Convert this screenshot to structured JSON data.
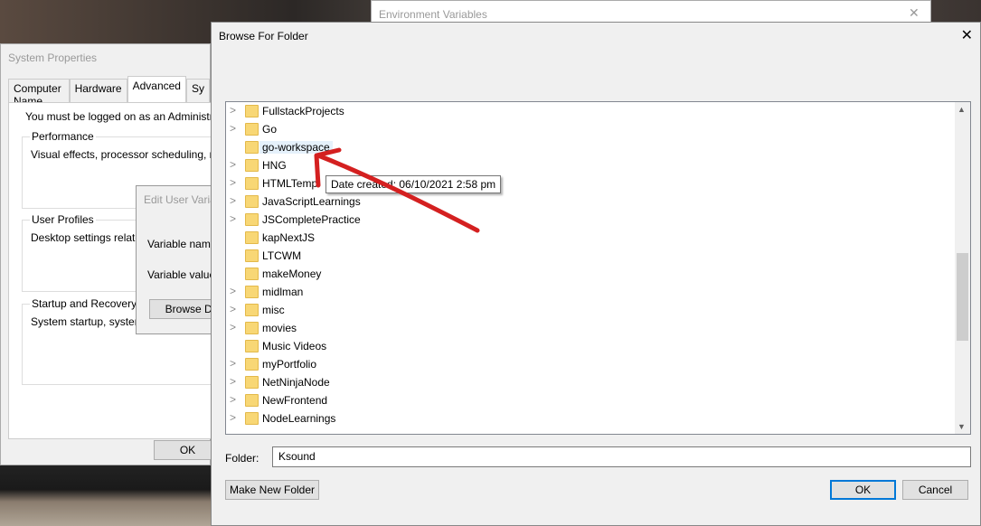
{
  "env_window": {
    "title": "Environment Variables",
    "close": "✕"
  },
  "system_properties": {
    "title": "System Properties",
    "tabs": [
      "Computer Name",
      "Hardware",
      "Advanced",
      "Sy"
    ],
    "notice": "You must be logged on as an Administrator t",
    "groups": [
      {
        "label": "Performance",
        "desc": "Visual effects, processor scheduling, memo"
      },
      {
        "label": "User Profiles",
        "desc": "Desktop settings related t"
      },
      {
        "label": "Startup and Recovery",
        "desc": "System startup, system fa"
      }
    ],
    "ok": "OK"
  },
  "edit_user_variable": {
    "title": "Edit User Varia",
    "name_label": "Variable nam",
    "value_label": "Variable value",
    "browse": "Browse Di"
  },
  "browse": {
    "title": "Browse For Folder",
    "close": "✕",
    "items": [
      {
        "name": "FullstackProjects",
        "expandable": true
      },
      {
        "name": "Go",
        "expandable": true
      },
      {
        "name": "go-workspace",
        "expandable": false,
        "selected": true
      },
      {
        "name": "HNG",
        "expandable": true
      },
      {
        "name": "HTMLTemp",
        "expandable": true
      },
      {
        "name": "JavaScriptLearnings",
        "expandable": true
      },
      {
        "name": "JSCompletePractice",
        "expandable": true
      },
      {
        "name": "kapNextJS",
        "expandable": false
      },
      {
        "name": "LTCWM",
        "expandable": false
      },
      {
        "name": "makeMoney",
        "expandable": false
      },
      {
        "name": "midlman",
        "expandable": true
      },
      {
        "name": "misc",
        "expandable": true
      },
      {
        "name": "movies",
        "expandable": true
      },
      {
        "name": "Music Videos",
        "expandable": false
      },
      {
        "name": "myPortfolio",
        "expandable": true
      },
      {
        "name": "NetNinjaNode",
        "expandable": true
      },
      {
        "name": "NewFrontend",
        "expandable": true
      },
      {
        "name": "NodeLearnings",
        "expandable": true
      }
    ],
    "tooltip": "Date created: 06/10/2021 2:58 pm",
    "folder_label": "Folder:",
    "folder_value": "Ksound",
    "make_new_folder": "Make New Folder",
    "ok": "OK",
    "cancel": "Cancel",
    "annotation_color": "#d42020"
  }
}
